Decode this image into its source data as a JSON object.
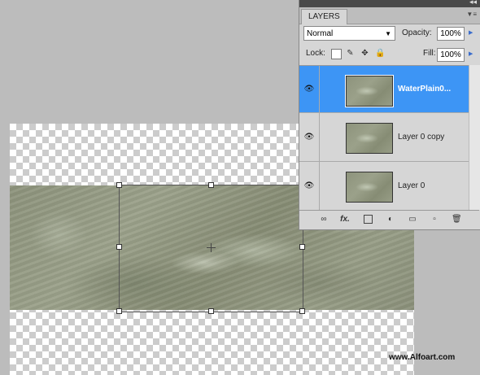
{
  "panel": {
    "tab_label": "LAYERS",
    "collapse_icon": "double-arrow-icon",
    "menu_icon": "panel-menu-icon",
    "blend_mode": "Normal",
    "opacity_label": "Opacity:",
    "opacity_value": "100%",
    "lock_label": "Lock:",
    "fill_label": "Fill:",
    "fill_value": "100%",
    "layers": [
      {
        "name": "WaterPlain0...",
        "selected": true
      },
      {
        "name": "Layer 0 copy",
        "selected": false
      },
      {
        "name": "Layer 0",
        "selected": false
      }
    ],
    "footer_icons": [
      "link-layers-icon",
      "fx-icon",
      "mask-icon",
      "adjustment-icon",
      "group-icon",
      "new-layer-icon",
      "trash-icon"
    ]
  },
  "watermark": "www.Alfoart.com",
  "colors": {
    "selection_blue": "#3d95f5",
    "panel_bg": "#d6d6d6",
    "canvas_bg": "#bcbcbc"
  }
}
